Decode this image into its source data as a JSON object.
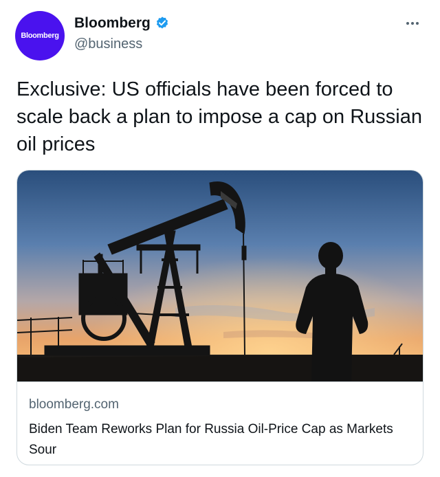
{
  "author": {
    "avatar_text": "Bloomberg",
    "display_name": "Bloomberg",
    "handle": "@business",
    "verified_icon": "verified-badge-icon",
    "avatar_color": "#4a12ee"
  },
  "menu": {
    "icon": "more-icon"
  },
  "tweet": {
    "text": "Exclusive: US officials have been forced to scale back a plan to impose a cap on Russian oil prices"
  },
  "card": {
    "domain": "bloomberg.com",
    "title": "Biden Team Reworks Plan for Russia Oil-Price Cap as Markets Sour",
    "image_alt": "Silhouette of a man beside an oil pumpjack at sunset"
  },
  "colors": {
    "accent": "#1d9bf0",
    "secondary_text": "#536471",
    "border": "#cfd9de"
  }
}
